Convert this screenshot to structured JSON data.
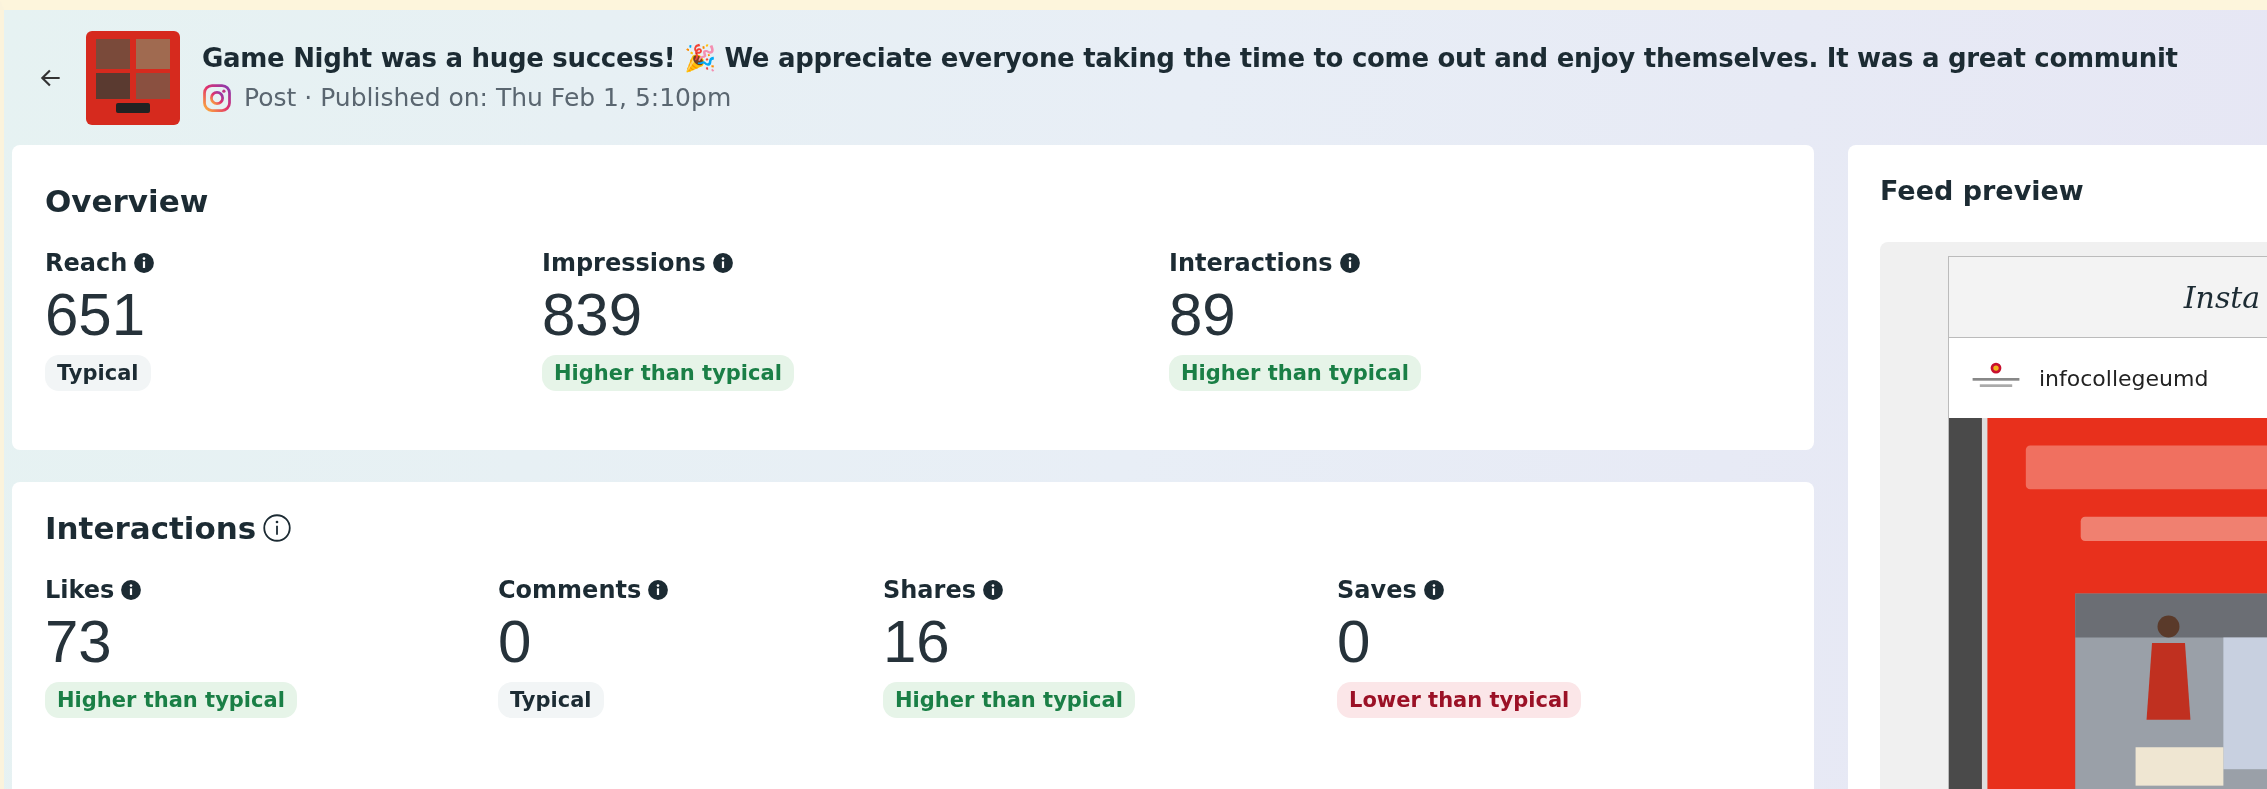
{
  "header": {
    "title": "Game Night was a huge success! 🎉 We appreciate everyone taking the time to come out and enjoy themselves. It was a great communit",
    "meta": "Post · Published on: Thu Feb 1, 5:10pm"
  },
  "overview": {
    "title": "Overview",
    "metrics": [
      {
        "label": "Reach",
        "value": "651",
        "badge": "Typical",
        "kind": "neutral"
      },
      {
        "label": "Impressions",
        "value": "839",
        "badge": "Higher than typical",
        "kind": "positive"
      },
      {
        "label": "Interactions",
        "value": "89",
        "badge": "Higher than typical",
        "kind": "positive"
      }
    ]
  },
  "interactions": {
    "title": "Interactions",
    "metrics": [
      {
        "label": "Likes",
        "value": "73",
        "badge": "Higher than typical",
        "kind": "positive"
      },
      {
        "label": "Comments",
        "value": "0",
        "badge": "Typical",
        "kind": "neutral"
      },
      {
        "label": "Shares",
        "value": "16",
        "badge": "Higher than typical",
        "kind": "positive"
      },
      {
        "label": "Saves",
        "value": "0",
        "badge": "Lower than typical",
        "kind": "negative"
      }
    ]
  },
  "feed_preview": {
    "title": "Feed preview",
    "app_name": "Insta",
    "account": "infocollegeumd"
  }
}
